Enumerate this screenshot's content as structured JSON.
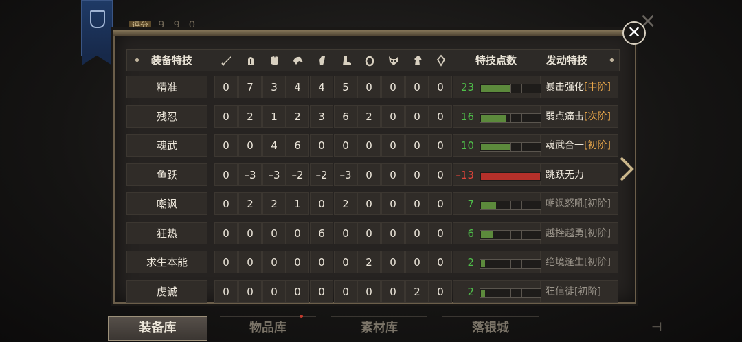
{
  "header": {
    "behind_label": "评分",
    "behind_value": "9 9 0",
    "col_skill": "装备特技",
    "col_points": "特技点数",
    "col_active": "发动特技",
    "icons": [
      "sword-icon",
      "helmet-icon",
      "armor-icon",
      "pauldron-icon",
      "gauntlet-icon",
      "boot-icon",
      "ring-icon",
      "demon-mask-icon",
      "horse-icon",
      "gem-icon"
    ]
  },
  "rows": [
    {
      "name": "精准",
      "vals": [
        "0",
        "7",
        "3",
        "4",
        "4",
        "5",
        "0",
        "0",
        "0",
        "0"
      ],
      "points": "23",
      "fill": 0.5,
      "active": "暴击强化",
      "level": "[中阶]",
      "dim": false,
      "neg": false
    },
    {
      "name": "残忍",
      "vals": [
        "0",
        "2",
        "1",
        "2",
        "3",
        "6",
        "2",
        "0",
        "0",
        "0"
      ],
      "points": "16",
      "fill": 0.42,
      "active": "弱点痛击",
      "level": "[次阶]",
      "dim": false,
      "neg": false
    },
    {
      "name": "魂武",
      "vals": [
        "0",
        "0",
        "4",
        "6",
        "0",
        "0",
        "0",
        "0",
        "0",
        "0"
      ],
      "points": "10",
      "fill": 0.5,
      "active": "魂武合一",
      "level": "[初阶]",
      "dim": false,
      "neg": false
    },
    {
      "name": "鱼跃",
      "vals": [
        "0",
        "–3",
        "–3",
        "–2",
        "–2",
        "–3",
        "0",
        "0",
        "0",
        "0"
      ],
      "points": "–13",
      "fill": 1.0,
      "active": "跳跃无力",
      "level": "",
      "dim": false,
      "neg": true
    },
    {
      "name": "嘲讽",
      "vals": [
        "0",
        "2",
        "2",
        "1",
        "0",
        "2",
        "0",
        "0",
        "0",
        "0"
      ],
      "points": "7",
      "fill": 0.25,
      "active": "嘲讽怒吼[初阶]",
      "level": "",
      "dim": true,
      "neg": false
    },
    {
      "name": "狂热",
      "vals": [
        "0",
        "0",
        "0",
        "0",
        "6",
        "0",
        "0",
        "0",
        "0",
        "0"
      ],
      "points": "6",
      "fill": 0.2,
      "active": "越挫越勇[初阶]",
      "level": "",
      "dim": true,
      "neg": false
    },
    {
      "name": "求生本能",
      "vals": [
        "0",
        "0",
        "0",
        "0",
        "0",
        "0",
        "2",
        "0",
        "0",
        "0"
      ],
      "points": "2",
      "fill": 0.07,
      "active": "绝境逢生[初阶]",
      "level": "",
      "dim": true,
      "neg": false
    },
    {
      "name": "虔诚",
      "vals": [
        "0",
        "0",
        "0",
        "0",
        "0",
        "0",
        "0",
        "0",
        "2",
        "0"
      ],
      "points": "2",
      "fill": 0.07,
      "active": "狂信徒[初阶]",
      "level": "",
      "dim": true,
      "neg": false
    }
  ],
  "tabs": [
    "装备库",
    "物品库",
    "素材库",
    "落银城"
  ],
  "colors": {
    "green": "#5c8a3c",
    "red": "#b5302a",
    "gold": "#e8a64a",
    "points_green": "#4fc04a",
    "points_red": "#e0443a"
  }
}
